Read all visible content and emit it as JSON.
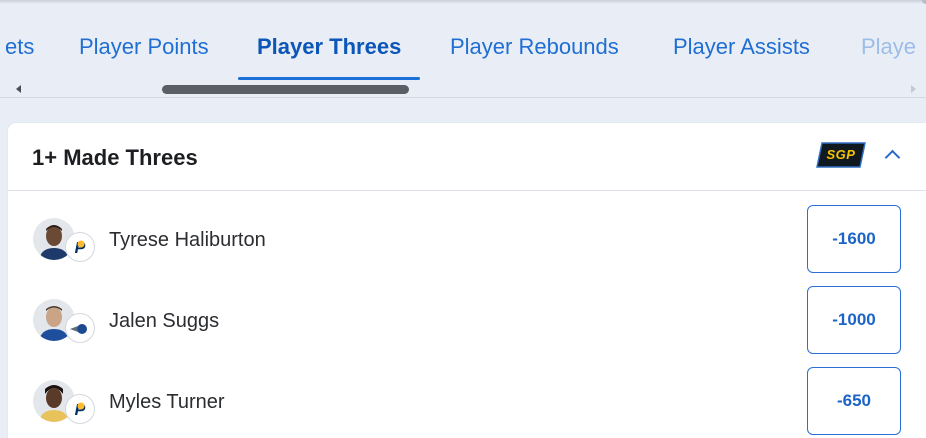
{
  "tabs": [
    {
      "label": "ets",
      "active": false
    },
    {
      "label": "Player Points",
      "active": false
    },
    {
      "label": "Player Threes",
      "active": true
    },
    {
      "label": "Player Rebounds",
      "active": false
    },
    {
      "label": "Player Assists",
      "active": false
    },
    {
      "label": "Playe",
      "active": false
    }
  ],
  "market": {
    "title": "1+ Made Threes",
    "badge": "SGP",
    "collapse_icon": "chevron-up-icon"
  },
  "players": [
    {
      "name": "Tyrese Haliburton",
      "team_logo": "pacers-logo",
      "odds": "-1600"
    },
    {
      "name": "Jalen Suggs",
      "team_logo": "magic-logo",
      "odds": "-1000"
    },
    {
      "name": "Myles Turner",
      "team_logo": "pacers-logo",
      "odds": "-650"
    }
  ],
  "colors": {
    "accent": "#1f6ed4",
    "background": "#e9eef6",
    "sgp_badge": "#f5c400"
  }
}
